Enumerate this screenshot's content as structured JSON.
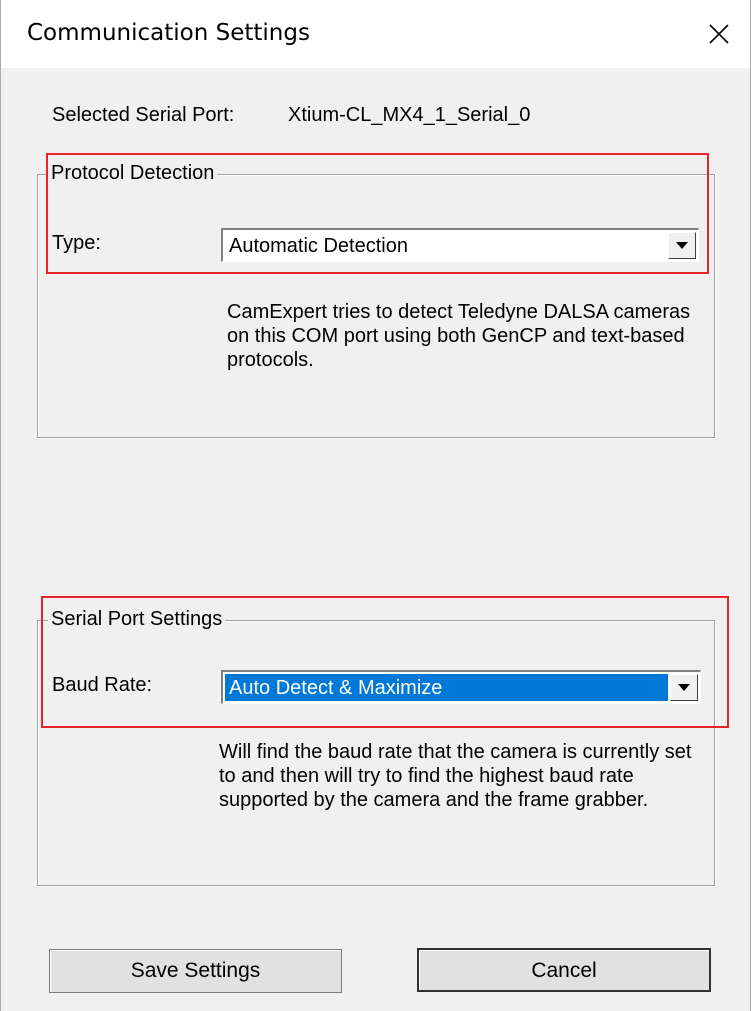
{
  "window": {
    "title": "Communication Settings"
  },
  "serial_port": {
    "label": "Selected Serial Port:",
    "value": "Xtium-CL_MX4_1_Serial_0"
  },
  "protocol_detection": {
    "legend": "Protocol Detection",
    "type_label": "Type:",
    "type_value": "Automatic Detection",
    "description": "CamExpert tries to detect Teledyne DALSA cameras on this COM port using both GenCP and text-based protocols."
  },
  "serial_port_settings": {
    "legend": "Serial Port Settings",
    "baud_label": "Baud Rate:",
    "baud_value": "Auto Detect & Maximize",
    "description": "Will find the baud rate that the camera is currently set to and then will try to find the highest baud rate supported by the camera and the frame grabber."
  },
  "buttons": {
    "save": "Save Settings",
    "cancel": "Cancel"
  },
  "colors": {
    "highlight": "#e8232d",
    "selection": "#0078d7"
  },
  "icons": {
    "close": "close-icon",
    "dropdown": "chevron-down-icon"
  }
}
